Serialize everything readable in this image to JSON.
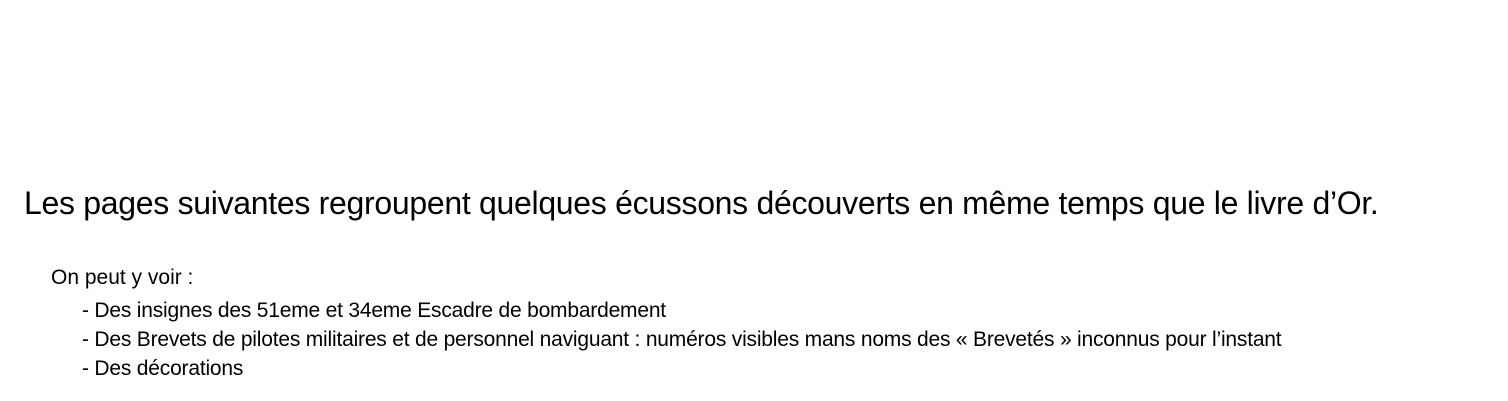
{
  "heading": "Les pages suivantes regroupent quelques écussons découverts en même temps que le livre d’Or.",
  "intro": "On peut y voir :",
  "bullets": [
    "- Des insignes des 51eme et 34eme Escadre de bombardement",
    "- Des Brevets de pilotes militaires et de personnel naviguant : numéros visibles mans noms des « Brevetés » inconnus pour l’instant",
    "- Des décorations"
  ]
}
